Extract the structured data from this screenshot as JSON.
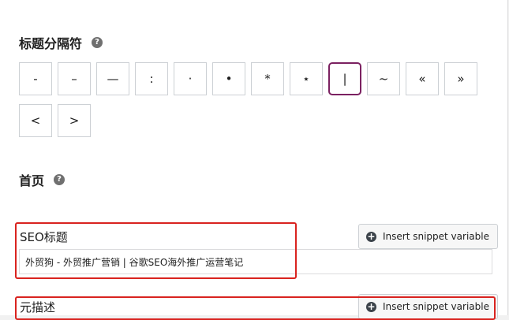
{
  "separator_section": {
    "title": "标题分隔符",
    "help": "?",
    "separators": [
      "-",
      "–",
      "—",
      ":",
      "·",
      "•",
      "*",
      "⋆",
      "|",
      "~",
      "«",
      "»",
      "<",
      ">"
    ],
    "selected": "|"
  },
  "homepage_section": {
    "title": "首页",
    "help": "?"
  },
  "seo_title": {
    "label": "SEO标题",
    "insert_button": "Insert snippet variable",
    "value": "外贸狗 - 外贸推广营销 | 谷歌SEO海外推广运营笔记"
  },
  "meta_description": {
    "label": "元描述",
    "insert_button": "Insert snippet variable"
  },
  "colors": {
    "selected_border": "#7b2161",
    "highlight_box": "#d9231f"
  }
}
